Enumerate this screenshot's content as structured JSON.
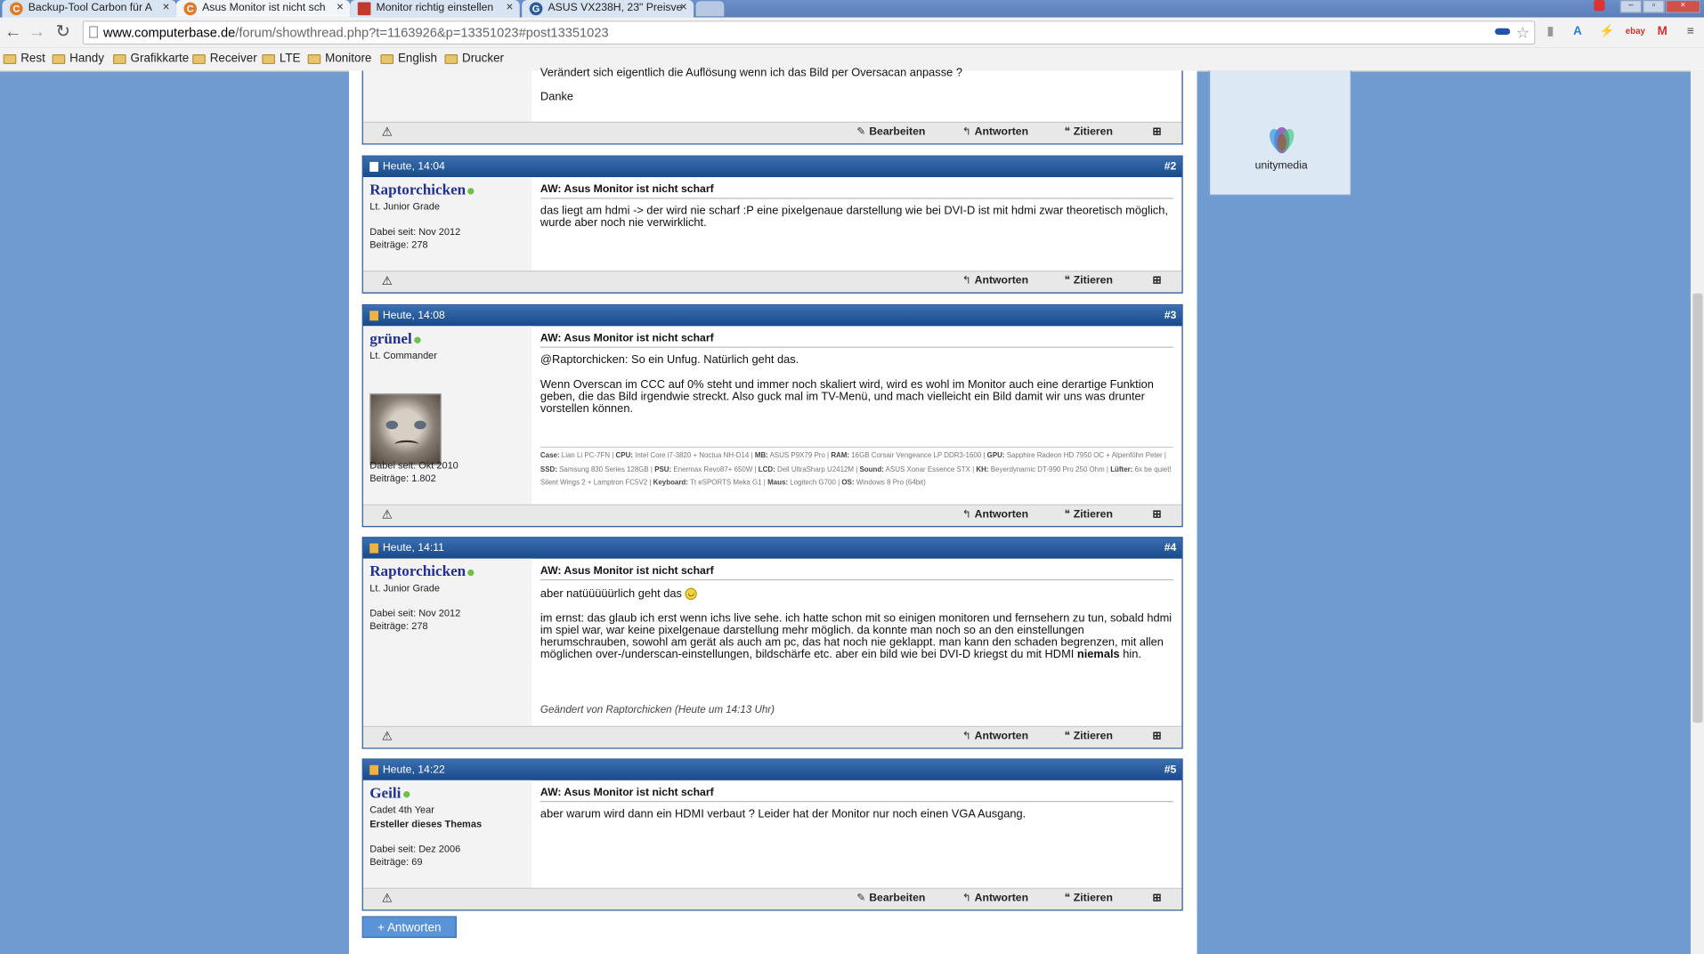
{
  "browser": {
    "tabs": [
      {
        "title": "Backup-Tool Carbon für A",
        "icon": "computerbase-icon"
      },
      {
        "title": "Asus Monitor ist nicht sch",
        "icon": "computerbase-icon",
        "active": true
      },
      {
        "title": "Monitor richtig einstellen",
        "icon": "page-icon"
      },
      {
        "title": "ASUS VX238H, 23\" Preisve",
        "icon": "geizhals-icon"
      }
    ],
    "url_host": "www.computerbase.de",
    "url_path": "/forum/showthread.php?t=1163926&p=13351023#post13351023",
    "bookmarks": [
      "Rest",
      "Handy",
      "Grafikkarte",
      "Receiver",
      "LTE",
      "Monitore",
      "English",
      "Drucker"
    ]
  },
  "colors": {
    "post_header": "#184a8a",
    "username": "#22308f",
    "online": "#6fc04a",
    "reply_button": "#5a93d6"
  },
  "previous_post": {
    "text_line1": "Verändert sich eigentlich die Auflösung wenn ich das Bild per Oversacan anpasse ?",
    "text_line2": "Danke",
    "actions": [
      "Bearbeiten",
      "Antworten",
      "Zitieren"
    ]
  },
  "sidebar": {
    "ad_brand": "unitymedia"
  },
  "posts": [
    {
      "date": "Heute, 14:04",
      "number": "#2",
      "username": "Raptorchicken",
      "rank": "Lt. Junior Grade",
      "joined": "Dabei seit: Nov 2012",
      "posts_count": "Beiträge: 278",
      "title": "AW: Asus Monitor ist nicht scharf",
      "body": [
        "das liegt am hdmi -> der wird nie scharf :P eine pixelgenaue darstellung wie bei DVI-D ist mit hdmi zwar theoretisch möglich, wurde aber noch nie verwirklicht."
      ],
      "actions": [
        "Antworten",
        "Zitieren"
      ]
    },
    {
      "date": "Heute, 14:08",
      "number": "#3",
      "username": "grünel",
      "rank": "Lt. Commander",
      "joined": "Dabei seit: Okt 2010",
      "posts_count": "Beiträge: 1.802",
      "title": "AW: Asus Monitor ist nicht scharf",
      "body": [
        "@Raptorchicken: So ein Unfug. Natürlich geht das.",
        "Wenn Overscan im CCC auf 0% steht und immer noch skaliert wird, wird es wohl im Monitor auch eine derartige Funktion geben, die das Bild irgendwie streckt. Also guck mal im TV-Menü, und mach vielleicht ein Bild damit wir uns was drunter vorstellen können."
      ],
      "signature": [
        {
          "k": "Case:",
          "v": "Lian Li PC-7FN"
        },
        {
          "k": "CPU:",
          "v": "Intel Core i7-3820 + Noctua NH-D14"
        },
        {
          "k": "MB:",
          "v": "ASUS P9X79 Pro"
        },
        {
          "k": "RAM:",
          "v": "16GB Corsair Vengeance LP DDR3-1600"
        },
        {
          "k": "GPU:",
          "v": "Sapphire Radeon HD 7950 OC + Alpenföhn Peter"
        },
        {
          "k": "SSD:",
          "v": "Samsung 830 Series 128GB"
        },
        {
          "k": "PSU:",
          "v": "Enermax Revo87+ 650W"
        },
        {
          "k": "LCD:",
          "v": "Dell UltraSharp U2412M"
        },
        {
          "k": "Sound:",
          "v": "ASUS Xonar Essence STX"
        },
        {
          "k": "KH:",
          "v": "Beyerdynamic DT-990 Pro 250 Ohm"
        },
        {
          "k": "Lüfter:",
          "v": "6x be quiet! Silent Wings 2 + Lamptron FC5V2"
        },
        {
          "k": "Keyboard:",
          "v": "Tt eSPORTS Meka G1"
        },
        {
          "k": "Maus:",
          "v": "Logitech G700"
        },
        {
          "k": "OS:",
          "v": "Windows 8 Pro (64bit)"
        }
      ],
      "actions": [
        "Antworten",
        "Zitieren"
      ]
    },
    {
      "date": "Heute, 14:11",
      "number": "#4",
      "username": "Raptorchicken",
      "rank": "Lt. Junior Grade",
      "joined": "Dabei seit: Nov 2012",
      "posts_count": "Beiträge: 278",
      "title": "AW: Asus Monitor ist nicht scharf",
      "body": [
        "aber natüüüüürlich geht das",
        "im ernst: das glaub ich erst wenn ichs live sehe. ich hatte schon mit so einigen monitoren und fernsehern zu tun, sobald hdmi im spiel war, war keine pixelgenaue darstellung mehr möglich. da konnte man noch so an den einstellungen herumschrauben, sowohl am gerät als auch am pc, das hat noch nie geklappt. man kann den schaden begrenzen, mit allen möglichen over-/underscan-einstellungen, bildschärfe etc. aber ein bild wie bei DVI-D kriegst du mit HDMI",
        "niemals",
        "hin."
      ],
      "edited": "Geändert von Raptorchicken (Heute um 14:13 Uhr)",
      "actions": [
        "Antworten",
        "Zitieren"
      ]
    },
    {
      "date": "Heute, 14:22",
      "number": "#5",
      "username": "Geili",
      "rank": "Cadet 4th Year",
      "role": "Ersteller dieses Themas",
      "joined": "Dabei seit: Dez 2006",
      "posts_count": "Beiträge: 69",
      "title": "AW: Asus Monitor ist nicht scharf",
      "body": [
        "aber warum wird dann ein HDMI verbaut ? Leider hat der Monitor nur noch einen VGA Ausgang."
      ],
      "actions": [
        "Bearbeiten",
        "Antworten",
        "Zitieren"
      ]
    }
  ],
  "reply_button": "+ Antworten"
}
